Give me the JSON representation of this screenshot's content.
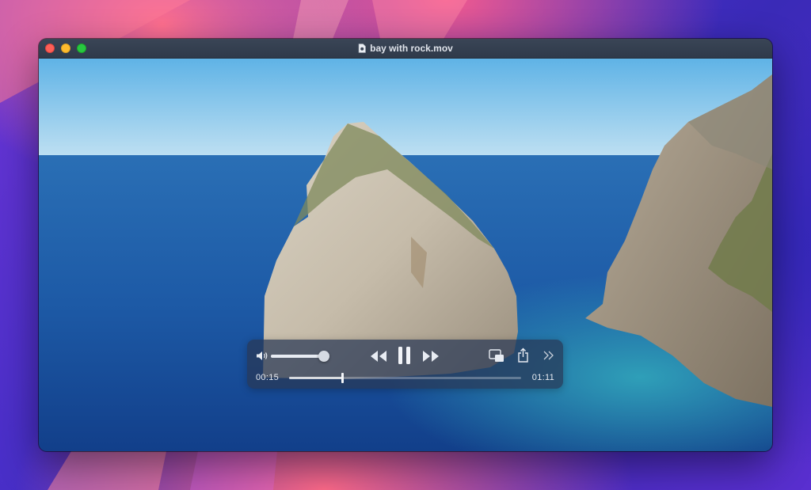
{
  "window": {
    "title": "bay with rock.mov",
    "title_icon": "document-icon"
  },
  "player": {
    "volume_fraction": 0.98,
    "current_time": "00:15",
    "duration": "01:11",
    "progress_fraction": 0.227,
    "state": "playing"
  },
  "controls": {
    "volume_icon": "speaker-icon",
    "rewind_icon": "rewind-icon",
    "play_pause_icon": "pause-icon",
    "forward_icon": "fast-forward-icon",
    "pip_icon": "picture-in-picture-icon",
    "share_icon": "share-icon",
    "more_icon": "chevron-double-right-icon"
  },
  "colors": {
    "close": "#fe5f57",
    "minimize": "#febc2e",
    "zoom": "#28c840"
  }
}
